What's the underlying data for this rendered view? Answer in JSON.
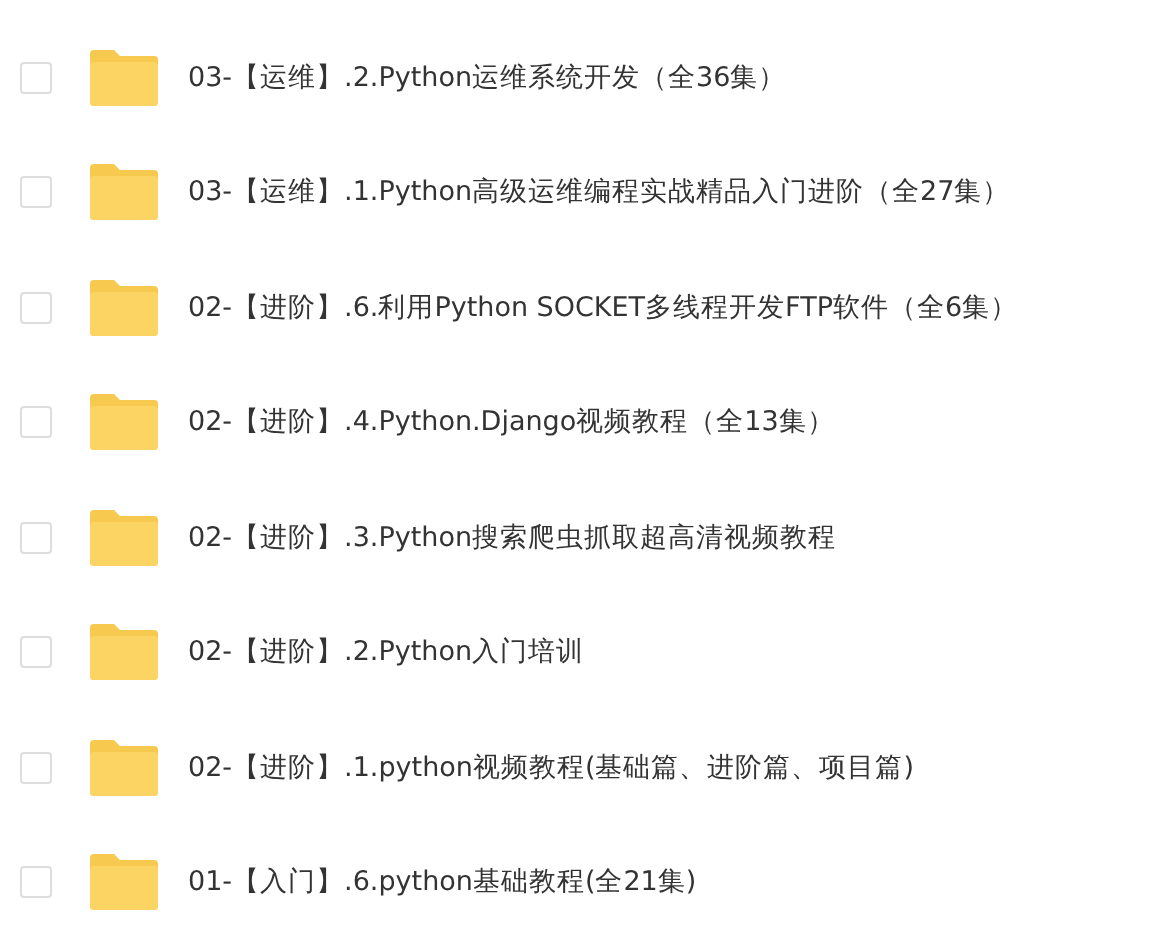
{
  "files": [
    {
      "name": "03-【运维】.2.Python运维系统开发（全36集）",
      "checked": false
    },
    {
      "name": "03-【运维】.1.Python高级运维编程实战精品入门进阶（全27集）",
      "checked": false
    },
    {
      "name": "02-【进阶】.6.利用Python SOCKET多线程开发FTP软件（全6集）",
      "checked": false
    },
    {
      "name": "02-【进阶】.4.Python.Django视频教程（全13集）",
      "checked": false
    },
    {
      "name": "02-【进阶】.3.Python搜索爬虫抓取超高清视频教程",
      "checked": false
    },
    {
      "name": "02-【进阶】.2.Python入门培训",
      "checked": false
    },
    {
      "name": "02-【进阶】.1.python视频教程(基础篇、进阶篇、项目篇)",
      "checked": false
    },
    {
      "name": "01-【入门】.6.python基础教程(全21集)",
      "checked": false
    }
  ]
}
